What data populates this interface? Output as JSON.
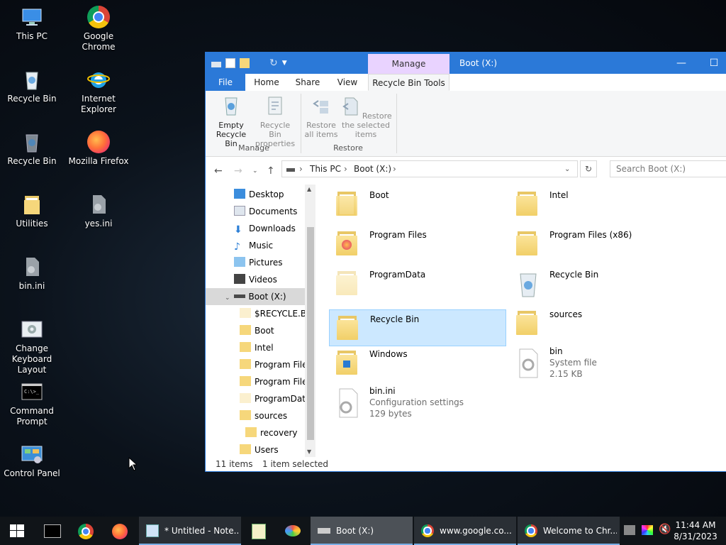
{
  "desktop": {
    "icons": [
      {
        "label": "This PC"
      },
      {
        "label": "Google Chrome"
      },
      {
        "label": "Recycle Bin"
      },
      {
        "label": "Internet Explorer"
      },
      {
        "label": "Recycle Bin"
      },
      {
        "label": "Mozilla Firefox"
      },
      {
        "label": "Utilities"
      },
      {
        "label": "yes.ini"
      },
      {
        "label": "bin.ini"
      },
      {
        "label": "Change Keyboard Layout"
      },
      {
        "label": "Command Prompt"
      },
      {
        "label": "Control Panel"
      }
    ]
  },
  "explorer": {
    "title": "Boot (X:)",
    "manage_tab": "Manage",
    "tabs": [
      "File",
      "Home",
      "Share",
      "View",
      "Recycle Bin Tools"
    ],
    "ribbon": {
      "buttons": [
        "Empty Recycle Bin",
        "Recycle Bin properties",
        "Restore all items",
        "Restore the selected items"
      ],
      "groups": [
        "Manage",
        "Restore"
      ]
    },
    "address": {
      "crumbs": [
        "This PC",
        "Boot (X:)"
      ]
    },
    "search_placeholder": "Search Boot (X:)",
    "nav": [
      "Desktop",
      "Documents",
      "Downloads",
      "Music",
      "Pictures",
      "Videos",
      "Boot (X:)",
      "$RECYCLE.BIN",
      "Boot",
      "Intel",
      "Program Files",
      "Program Files",
      "ProgramData",
      "sources",
      "recovery",
      "Users"
    ],
    "files": [
      {
        "name": "Boot"
      },
      {
        "name": "Intel"
      },
      {
        "name": "Program Files"
      },
      {
        "name": "Program Files (x86)"
      },
      {
        "name": "ProgramData"
      },
      {
        "name": "Recycle Bin"
      },
      {
        "name": "Recycle Bin"
      },
      {
        "name": "sources"
      },
      {
        "name": "Windows"
      },
      {
        "name": "bin",
        "type": "System file",
        "size": "2.15 KB"
      },
      {
        "name": "bin.ini",
        "type": "Configuration settings",
        "size": "129 bytes"
      }
    ],
    "status": {
      "count": "11 items",
      "selected": "1 item selected"
    }
  },
  "taskbar": {
    "tasks": [
      "* Untitled - Note...",
      "Boot (X:)",
      "www.google.co...",
      "Welcome to Chr..."
    ],
    "clock": {
      "time": "11:44 AM",
      "date": "8/31/2023"
    }
  }
}
